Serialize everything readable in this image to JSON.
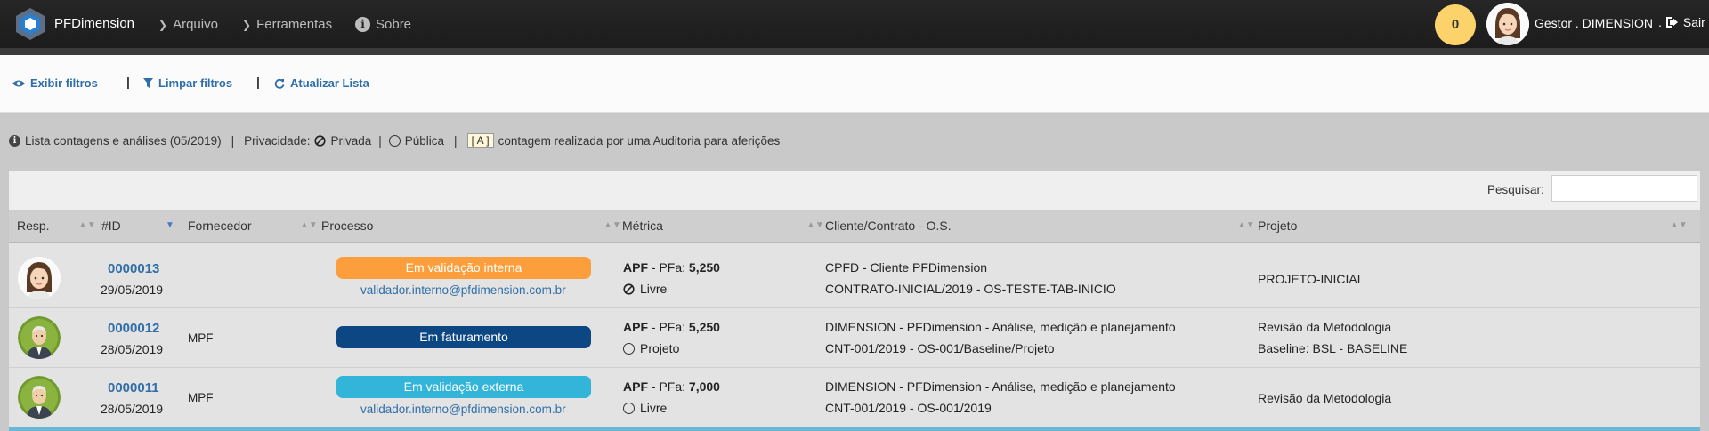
{
  "app": {
    "brand": "PFDimension"
  },
  "nav": {
    "arquivo": "Arquivo",
    "ferramentas": "Ferramentas",
    "sobre": "Sobre"
  },
  "header": {
    "notifications": "0",
    "user_name": "Gestor . DIMENSION",
    "logout_prefix": ".",
    "logout": "Sair"
  },
  "toolbar": {
    "show_filters": "Exibir filtros",
    "clear_filters": "Limpar filtros",
    "refresh": "Atualizar Lista",
    "separator": "|"
  },
  "info": {
    "list_text": "Lista contagens e análises (05/2019)",
    "sep": "|",
    "privacy_label": "Privacidade:",
    "private": "Privada",
    "public": "Pública",
    "audit_badge": "[ A ]",
    "audit_text": "contagem realizada por uma Auditoria para aferições"
  },
  "search": {
    "label": "Pesquisar:",
    "value": ""
  },
  "table": {
    "columns": [
      "Resp.",
      "#ID",
      "Fornecedor",
      "Processo",
      "Métrica",
      "Cliente/Contrato - O.S.",
      "Projeto"
    ],
    "rows": [
      {
        "id": "0000013",
        "date": "29/05/2019",
        "fornecedor": "",
        "status": "Em validação interna",
        "status_color": "#fc9e3b",
        "validator": "validador.interno@pfdimension.com.br",
        "metric_type": "APF",
        "metric_label": " - PFa: ",
        "metric_value": "5,250",
        "privacy": "Livre",
        "privacy_icon": "ban-icon",
        "cliente": "CPFD - Cliente PFDimension",
        "contrato": "CONTRATO-INICIAL/2019 - OS-TESTE-TAB-INICIO",
        "projeto": "PROJETO-INICIAL",
        "projeto2": ""
      },
      {
        "id": "0000012",
        "date": "28/05/2019",
        "fornecedor": "MPF",
        "status": "Em faturamento",
        "status_color": "#0c4683",
        "validator": "",
        "metric_type": "APF",
        "metric_label": " - PFa: ",
        "metric_value": "5,250",
        "privacy": "Projeto",
        "privacy_icon": "circle-icon",
        "cliente": "DIMENSION - PFDimension - Análise, medição e planejamento",
        "contrato": "CNT-001/2019 - OS-001/Baseline/Projeto",
        "projeto": "Revisão da Metodologia",
        "projeto2": "Baseline: BSL - BASELINE"
      },
      {
        "id": "0000011",
        "date": "28/05/2019",
        "fornecedor": "MPF",
        "status": "Em validação externa",
        "status_color": "#33b4d9",
        "validator": "validador.interno@pfdimension.com.br",
        "metric_type": "APF",
        "metric_label": " - PFa: ",
        "metric_value": "7,000",
        "privacy": "Livre",
        "privacy_icon": "circle-icon",
        "cliente": "DIMENSION - PFDimension - Análise, medição e planejamento",
        "contrato": "CNT-001/2019 - OS-001/2019",
        "projeto": "Revisão da Metodologia",
        "projeto2": ""
      }
    ]
  }
}
